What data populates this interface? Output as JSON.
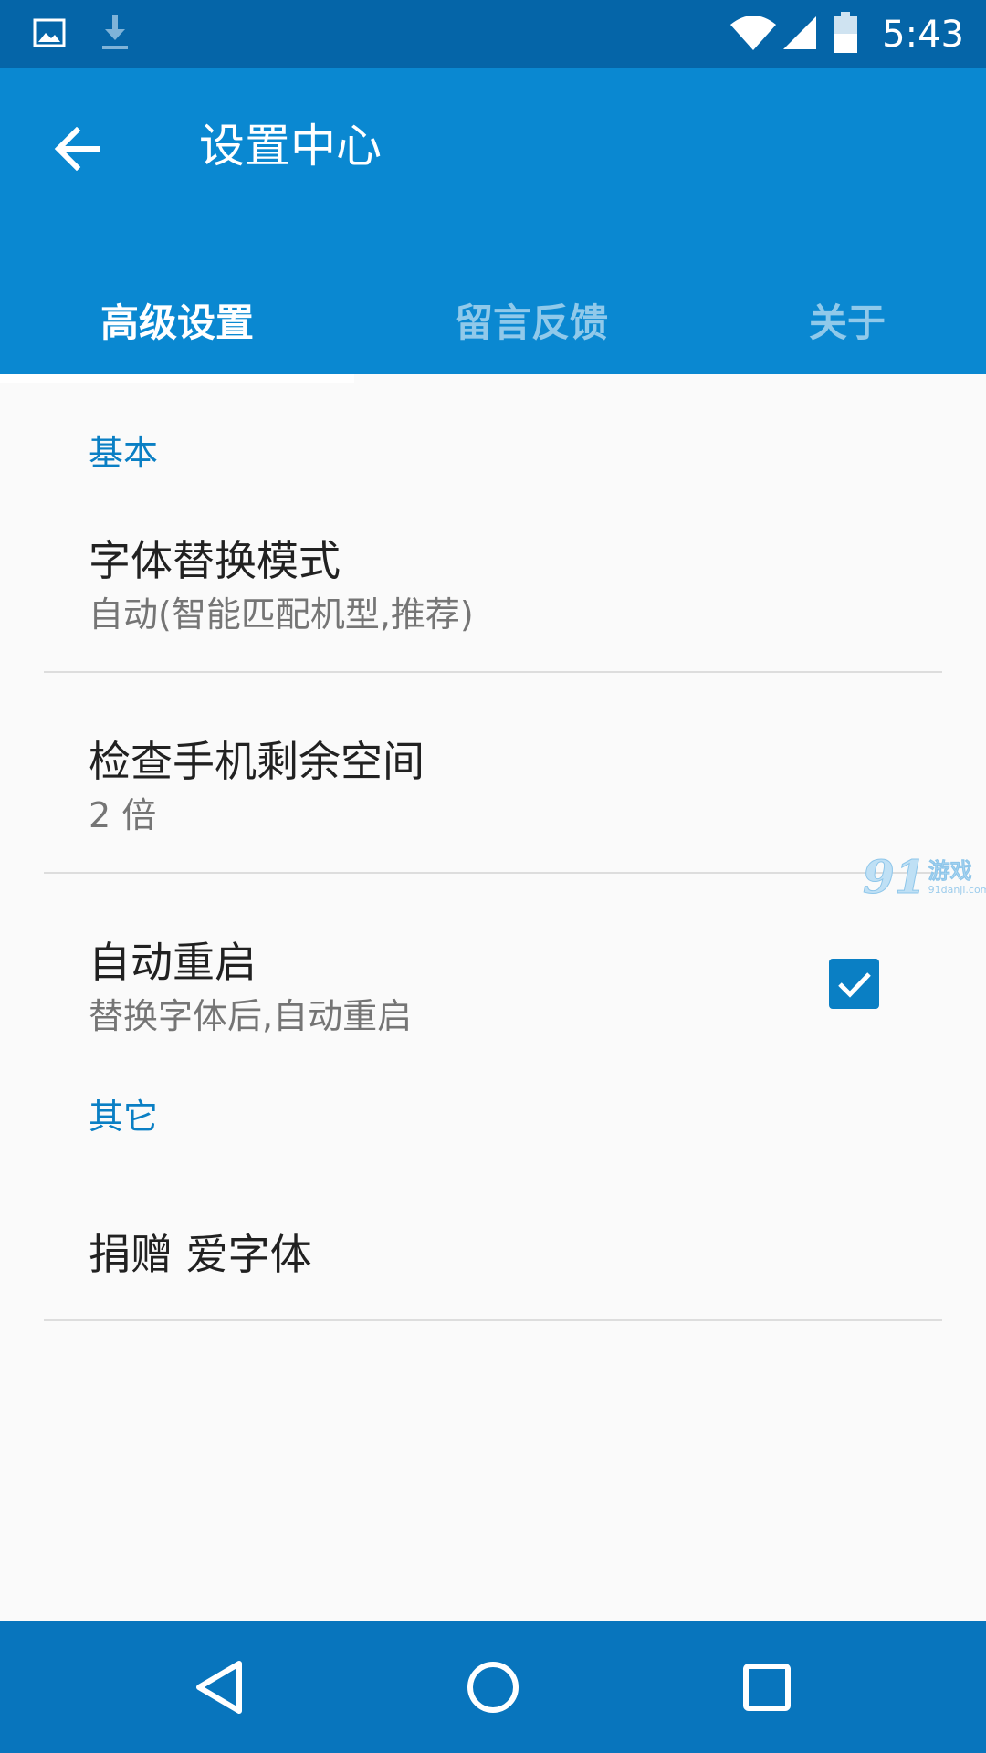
{
  "status_bar": {
    "time": "5:43",
    "icons": [
      "image-icon",
      "download-icon",
      "wifi-icon",
      "signal-icon",
      "battery-icon"
    ]
  },
  "app_bar": {
    "title": "设置中心",
    "back_icon": "arrow-back-icon"
  },
  "tabs": [
    {
      "label": "高级设置",
      "active": true
    },
    {
      "label": "留言反馈",
      "active": false
    },
    {
      "label": "关于",
      "active": false
    }
  ],
  "sections": {
    "basic": {
      "header": "基本",
      "font_replace": {
        "title": "字体替换模式",
        "summary": "自动(智能匹配机型,推荐)"
      },
      "check_space": {
        "title": "检查手机剩余空间",
        "summary": "2 倍"
      },
      "auto_restart": {
        "title": "自动重启",
        "summary": "替换字体后,自动重启",
        "checked": true
      }
    },
    "other": {
      "header": "其它",
      "donate": {
        "title": "捐赠 爱字体"
      }
    }
  },
  "watermark": {
    "number": "91",
    "text": "游戏",
    "url": "91danji.com"
  },
  "nav_bar": {
    "icons": [
      "back-triangle-icon",
      "home-circle-icon",
      "recents-square-icon"
    ]
  },
  "colors": {
    "status_bar": "#0565a8",
    "app_bar": "#0a88d1",
    "accent": "#0a7fc4",
    "nav_bar": "#0875bd",
    "background": "#fafafa"
  }
}
